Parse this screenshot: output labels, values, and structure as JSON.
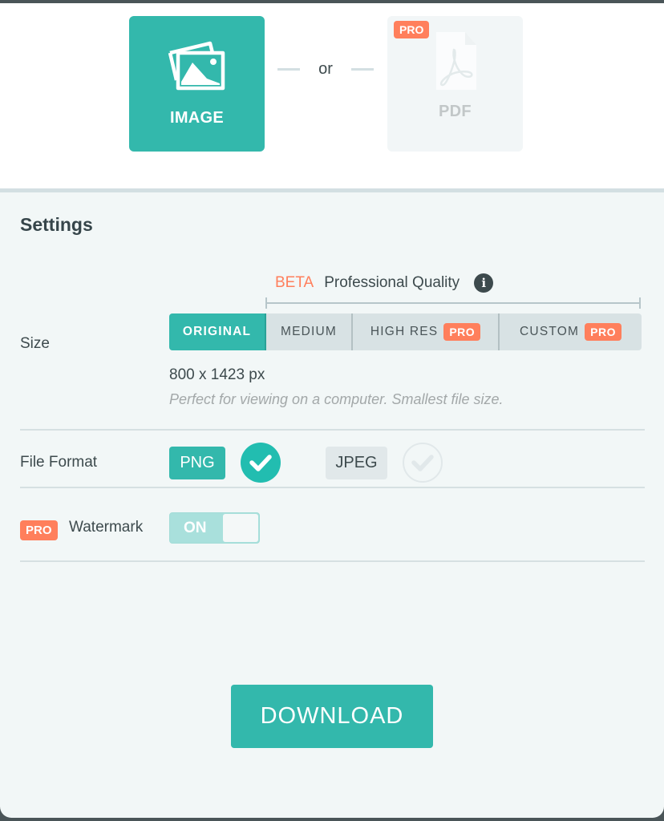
{
  "export_types": {
    "image": {
      "label": "IMAGE",
      "icon": "image-icon",
      "selected": true
    },
    "separator": "or",
    "pdf": {
      "label": "PDF",
      "icon": "pdf-icon",
      "badge": "PRO",
      "selected": false
    }
  },
  "settings": {
    "title": "Settings",
    "size": {
      "label": "Size",
      "beta_tag": "BETA",
      "quality_label": "Professional Quality",
      "info_icon": "i",
      "options": [
        {
          "label": "ORIGINAL",
          "selected": true
        },
        {
          "label": "MEDIUM"
        },
        {
          "label": "HIGH RES",
          "badge": "PRO"
        },
        {
          "label": "CUSTOM",
          "badge": "PRO"
        }
      ],
      "dimensions": "800 x 1423 px",
      "description": "Perfect for viewing on a computer. Smallest file size."
    },
    "file_format": {
      "label": "File Format",
      "options": [
        {
          "label": "PNG",
          "selected": true
        },
        {
          "label": "JPEG",
          "selected": false
        }
      ]
    },
    "watermark": {
      "badge": "PRO",
      "label": "Watermark",
      "toggle_label": "ON",
      "enabled": true
    }
  },
  "download_label": "DOWNLOAD",
  "colors": {
    "accent": "#33b8ac",
    "pro": "#ff7f5c",
    "text": "#3d4a4d"
  }
}
